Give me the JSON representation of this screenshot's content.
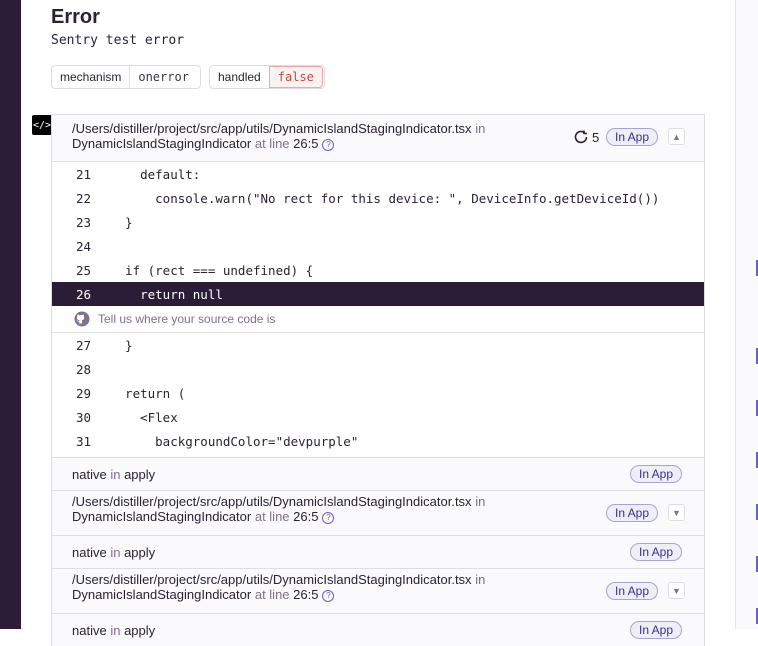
{
  "error": {
    "title": "Error",
    "message": "Sentry test error"
  },
  "tags": [
    {
      "key": "mechanism",
      "value": "onerror"
    },
    {
      "key": "handled",
      "value": "false"
    }
  ],
  "code_badge": "</>",
  "frames": {
    "main": {
      "path": "/Users/distiller/project/src/app/utils/DynamicIslandStagingIndicator.tsx",
      "in_word": "in",
      "function": "DynamicIslandStagingIndicator",
      "at_line_word": "at line",
      "location": "26:5",
      "repeat_count": "5",
      "in_app_label": "In App",
      "lines": [
        {
          "num": "21",
          "code": "    default:"
        },
        {
          "num": "22",
          "code": "      console.warn(\"No rect for this device: \", DeviceInfo.getDeviceId())"
        },
        {
          "num": "23",
          "code": "  }"
        },
        {
          "num": "24",
          "code": ""
        },
        {
          "num": "25",
          "code": "  if (rect === undefined) {"
        },
        {
          "num": "26",
          "code": "    return null"
        }
      ],
      "source_hint": "Tell us where your source code is",
      "lines_after": [
        {
          "num": "27",
          "code": "  }"
        },
        {
          "num": "28",
          "code": ""
        },
        {
          "num": "29",
          "code": "  return ("
        },
        {
          "num": "30",
          "code": "    <Flex"
        },
        {
          "num": "31",
          "code": "      backgroundColor=\"devpurple\""
        }
      ]
    },
    "native": {
      "module": "native",
      "in_word": "in",
      "function": "apply",
      "in_app_label": "In App"
    },
    "collapsed": {
      "path": "/Users/distiller/project/src/app/utils/DynamicIslandStagingIndicator.tsx",
      "in_word": "in",
      "function": "DynamicIslandStagingIndicator",
      "at_line_word": "at line",
      "location": "26:5",
      "in_app_label": "In App"
    }
  },
  "colors": {
    "accent": "#6c5fc7",
    "active_line_bg": "#2b1d38",
    "false_tag": "#c5463f"
  }
}
